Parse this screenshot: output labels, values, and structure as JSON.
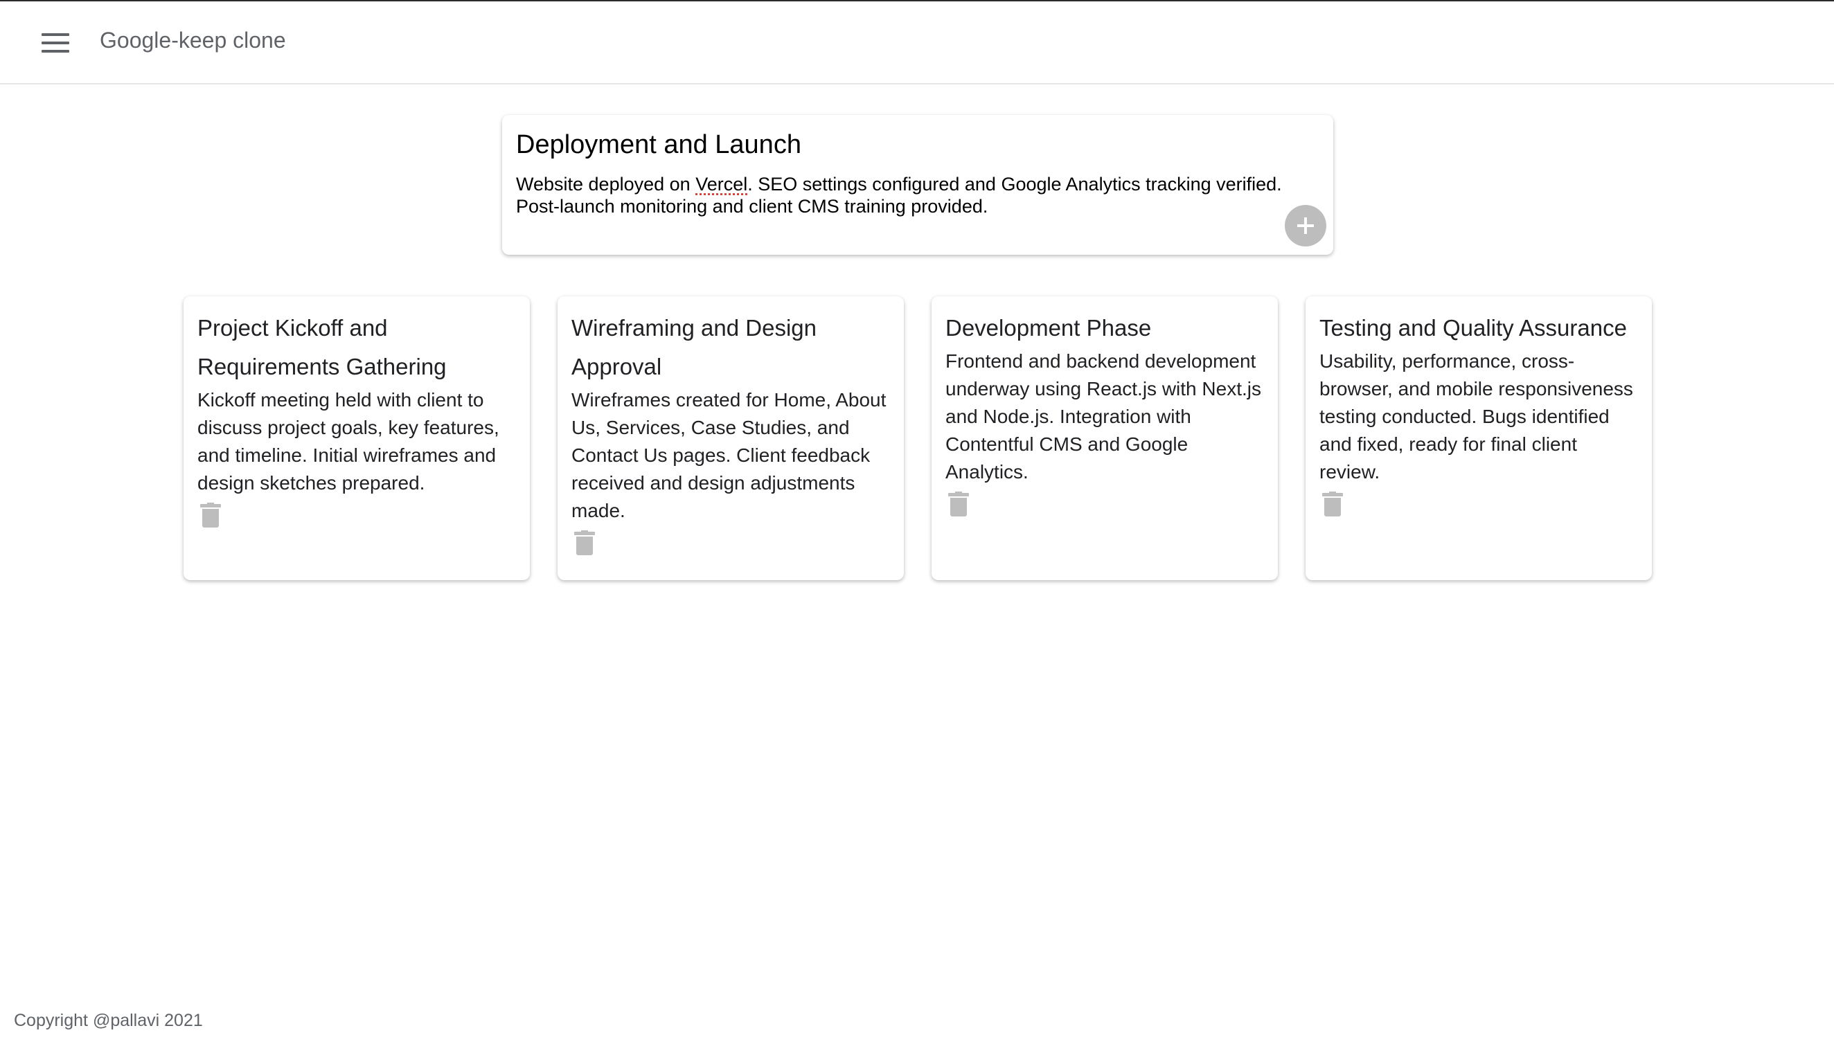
{
  "header": {
    "title": "Google-keep clone"
  },
  "compose": {
    "title": "Deployment and Launch",
    "body_before": "Website deployed on ",
    "body_link": "Vercel",
    "body_after": ". SEO settings configured and Google Analytics tracking verified. Post-launch monitoring and client CMS training provided."
  },
  "notes": [
    {
      "title": "Project Kickoff and Requirements Gathering",
      "body": "Kickoff meeting held with client to discuss project goals, key features, and timeline. Initial wireframes and design sketches prepared."
    },
    {
      "title": "Wireframing and Design Approval",
      "body": "Wireframes created for Home, About Us, Services, Case Studies, and Contact Us pages. Client feedback received and design adjustments made."
    },
    {
      "title": "Development Phase",
      "body": "Frontend and backend development underway using React.js with Next.js and Node.js. Integration with Contentful CMS and Google Analytics."
    },
    {
      "title": "Testing and Quality Assurance",
      "body": "Usability, performance, cross-browser, and mobile responsiveness testing conducted. Bugs identified and fixed, ready for final client review."
    }
  ],
  "footer": {
    "text": "Copyright @pallavi 2021"
  },
  "icons": {
    "menu": "hamburger-menu-icon",
    "add": "plus-icon",
    "delete": "trash-icon"
  },
  "colors": {
    "accent_button": "#bdbdbd",
    "header_text": "#5f6368"
  }
}
